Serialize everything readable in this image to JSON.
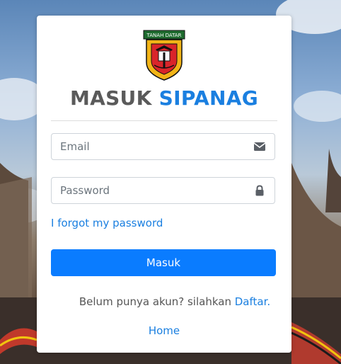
{
  "logo": {
    "banner_text": "TANAH DATAR",
    "name": "tanah-datar-emblem"
  },
  "title": {
    "part1": "MASUK",
    "part2": "SIPANAG"
  },
  "form": {
    "email_placeholder": "Email",
    "email_value": "",
    "password_placeholder": "Password",
    "password_value": "",
    "email_icon": "envelope-icon",
    "password_icon": "lock-icon"
  },
  "links": {
    "forgot": "I forgot my password",
    "register_prompt": "Belum punya akun? silahkan",
    "register_link": "Daftar.",
    "home": "Home"
  },
  "buttons": {
    "submit": "Masuk"
  },
  "colors": {
    "accent": "#0a7cff",
    "link": "#1a7fe0",
    "title_dark": "#5a5a5a"
  }
}
